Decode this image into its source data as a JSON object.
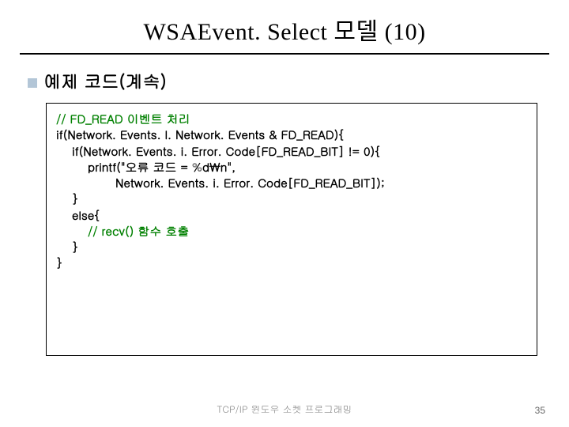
{
  "title": "WSAEvent. Select 모델 (10)",
  "subtitle": "예제 코드(계속)",
  "code": {
    "line1_comment": "// FD_READ 이벤트 처리",
    "line2": "if(Network. Events. l. Network. Events & FD_READ){",
    "line3": "if(Network. Events. i. Error. Code[FD_READ_BIT] != 0){",
    "line4": "printf(\"오류 코드 = %d\\n\",",
    "line5": "Network. Events. i. Error. Code[FD_READ_BIT]);",
    "line6": "}",
    "line7": "else{",
    "line8_comment": "// recv() 함수 호출",
    "line9": "}",
    "line10": "}"
  },
  "footer": "TCP/IP 윈도우 소켓 프로그래밍",
  "page_number": "35"
}
